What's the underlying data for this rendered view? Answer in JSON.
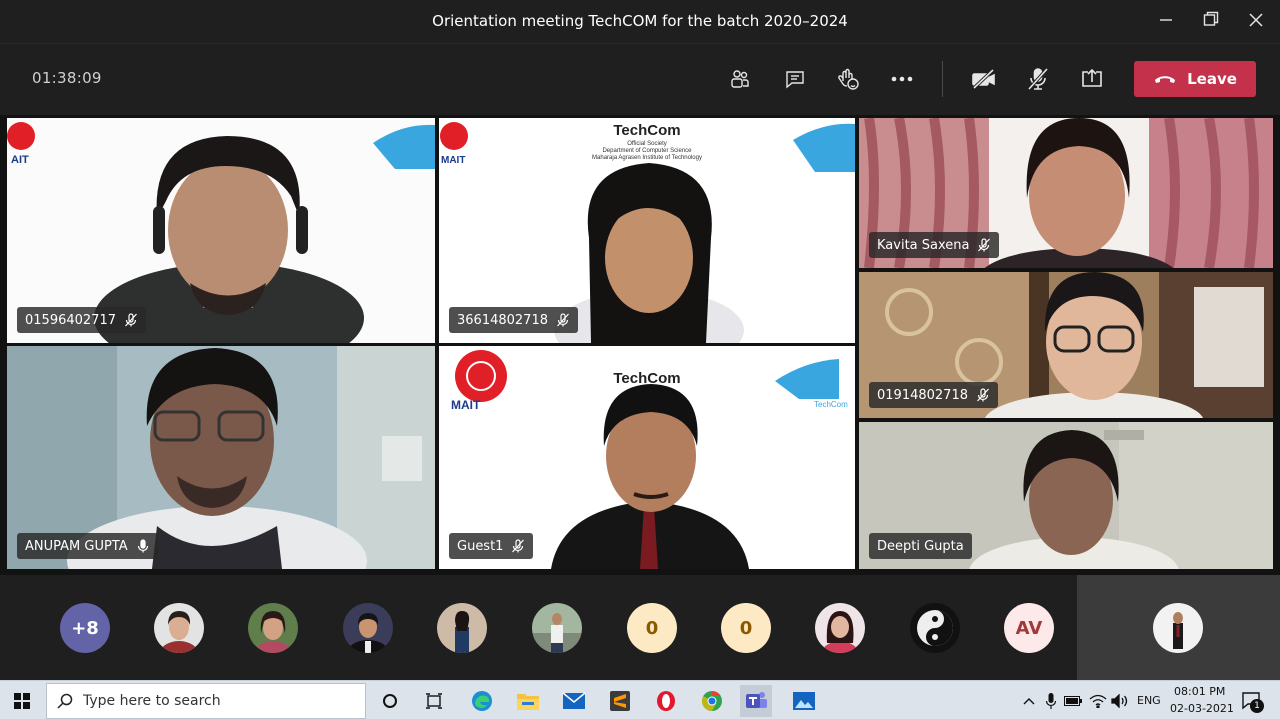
{
  "window": {
    "title": "Orientation meeting TechCOM for the batch 2020–2024"
  },
  "toolbar": {
    "timer": "01:38:09",
    "leave_label": "Leave",
    "icons": [
      "participants-icon",
      "chat-icon",
      "raise-hand-icon",
      "more-icon",
      "camera-off-icon",
      "mic-muted-icon",
      "share-screen-icon",
      "phone-hangup-icon"
    ]
  },
  "slides": {
    "org_title": "TechCom",
    "sub_line1": "Official Society",
    "sub_line2": "Department of Computer Science",
    "sub_line3": "Maharaja Agrasen Institute of Technology",
    "mait_label": "MAIT",
    "logo_text": "TechCom"
  },
  "participants": [
    {
      "name": "01596402717",
      "muted": true
    },
    {
      "name": "36614802718",
      "muted": true
    },
    {
      "name": "Kavita Saxena",
      "muted": true
    },
    {
      "name": "01914802718",
      "muted": true
    },
    {
      "name": "ANUPAM GUPTA",
      "muted": false
    },
    {
      "name": "Guest1",
      "muted": true
    },
    {
      "name": "Deepti Gupta",
      "muted": false
    }
  ],
  "roster": {
    "overflow": "+8",
    "initials_1": "0",
    "initials_2": "0",
    "initials_3": "AV"
  },
  "colors": {
    "leave": "#c4314b",
    "overflow_badge": "#6264a7",
    "initial_badge": "#fde9c3"
  },
  "taskbar": {
    "search_placeholder": "Type here to search",
    "lang": "ENG",
    "time": "08:01 PM",
    "date": "02-03-2021",
    "notifications": "1"
  }
}
